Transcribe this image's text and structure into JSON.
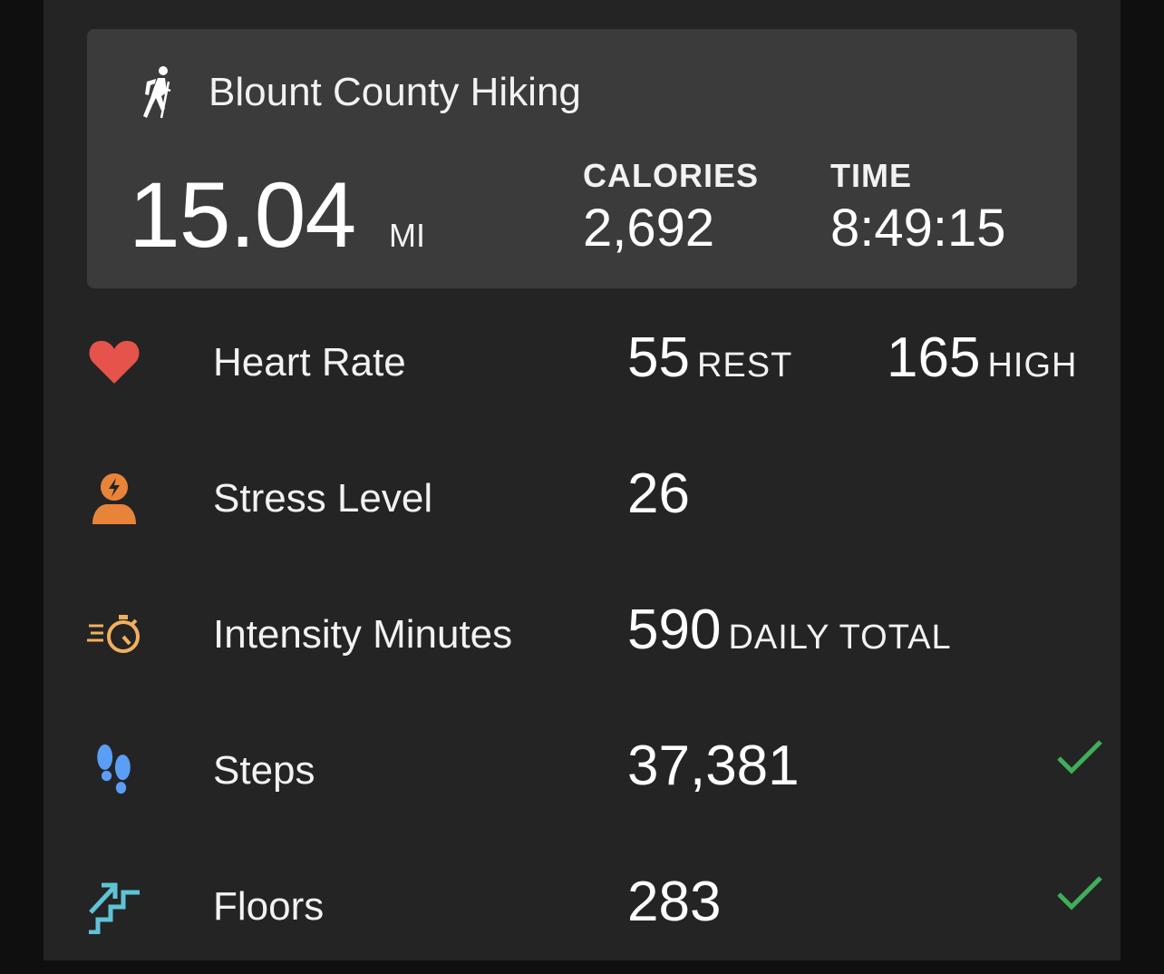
{
  "activity": {
    "icon": "hiker-icon",
    "title": "Blount County Hiking",
    "distance": "15.04",
    "distance_unit": "MI",
    "calories_label": "CALORIES",
    "calories_value": "2,692",
    "time_label": "TIME",
    "time_value": "8:49:15"
  },
  "metrics": {
    "heart_rate": {
      "icon": "heart-icon",
      "label": "Heart Rate",
      "rest_value": "55",
      "rest_unit": "REST",
      "high_value": "165",
      "high_unit": "HIGH"
    },
    "stress": {
      "icon": "stress-person-icon",
      "label": "Stress Level",
      "value": "26"
    },
    "intensity": {
      "icon": "stopwatch-icon",
      "label": "Intensity Minutes",
      "value": "590",
      "unit": "DAILY TOTAL"
    },
    "steps": {
      "icon": "footprints-icon",
      "label": "Steps",
      "value": "37,381",
      "goal_met": true
    },
    "floors": {
      "icon": "stairs-icon",
      "label": "Floors",
      "value": "283",
      "goal_met": true
    }
  },
  "colors": {
    "background": "#242424",
    "card": "#3b3b3b",
    "heart": "#e5534b",
    "stress": "#e8843a",
    "intensity": "#f0b060",
    "steps": "#5b9ef5",
    "floors": "#5fc3d6",
    "check": "#3fae5a"
  }
}
